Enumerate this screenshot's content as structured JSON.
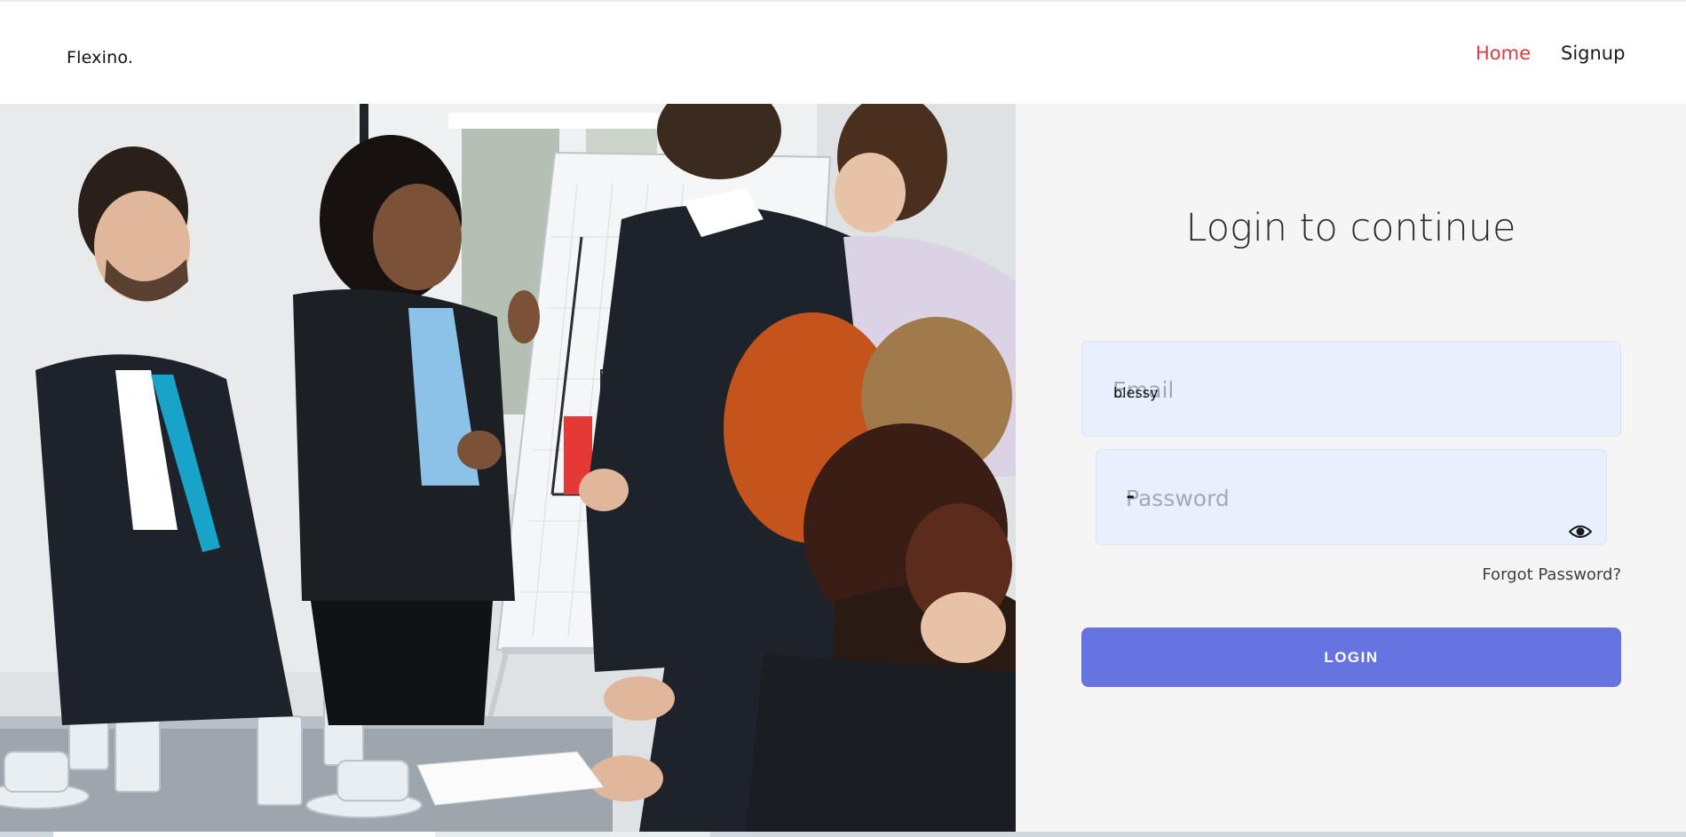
{
  "header": {
    "logo": "Flexino.",
    "nav": {
      "home": "Home",
      "signup": "Signup"
    }
  },
  "login": {
    "title": "Login to continue",
    "email": {
      "placeholder": "Email",
      "value": "blessy"
    },
    "password": {
      "placeholder": "Password",
      "masked_value": "•••"
    },
    "show_password_icon": "eye-icon",
    "forgot_password": "Forgot Password?",
    "submit_label": "LOGIN"
  },
  "colors": {
    "accent": "#6674e1",
    "nav_active": "#e0393e",
    "field_bg": "#e8f0fe",
    "panel_bg": "#f5f5f5"
  }
}
